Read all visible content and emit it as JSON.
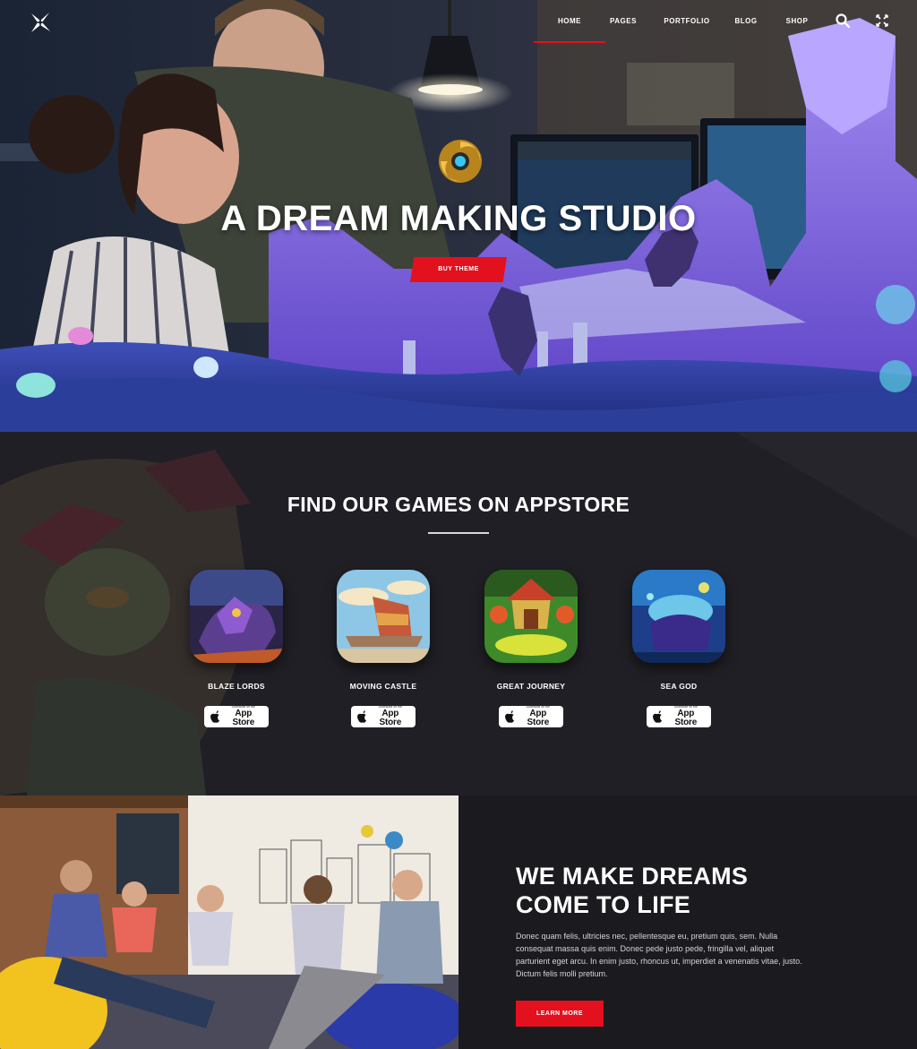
{
  "nav": {
    "logo_icon": "star-x-logo",
    "items": [
      {
        "label": "HOME",
        "active": true
      },
      {
        "label": "PAGES",
        "active": false
      },
      {
        "label": "PORTFOLIO",
        "active": false
      },
      {
        "label": "BLOG",
        "active": false
      },
      {
        "label": "SHOP",
        "active": false
      }
    ],
    "search_icon": "search-icon",
    "close_icon": "close-icon"
  },
  "hero": {
    "title": "A DREAM MAKING STUDIO",
    "button_label": "BUY THEME",
    "emblem_icon": "golden-swirl-emblem"
  },
  "games": {
    "title": "FIND OUR GAMES ON APPSTORE",
    "store_small": "Download on the",
    "store_big": "App Store",
    "items": [
      {
        "name": "BLAZE LORDS"
      },
      {
        "name": "MOVING CASTLE"
      },
      {
        "name": "GREAT JOURNEY"
      },
      {
        "name": "SEA GOD"
      }
    ]
  },
  "about": {
    "title_line1": "WE MAKE DREAMS",
    "title_line2": "COME TO LIFE",
    "body": "Donec quam felis, ultricies nec, pellentesque eu, pretium quis, sem. Nulla consequat massa quis enim. Donec pede justo pede, fringilla vel, aliquet parturient eget arcu. In enim justo, rhoncus ut, imperdiet a venenatis vitae, justo. Dictum felis molli pretium.",
    "button_label": "LEARN MORE"
  },
  "colors": {
    "accent": "#e3101e",
    "dark_bg": "#1b1a1f"
  }
}
